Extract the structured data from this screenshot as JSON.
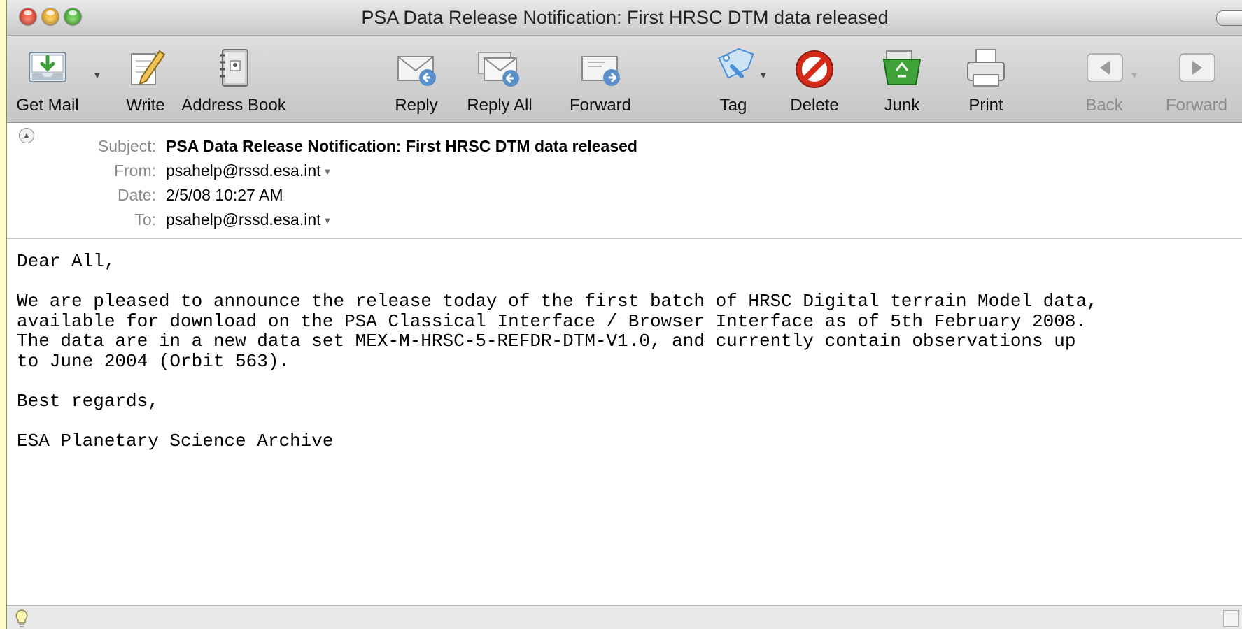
{
  "window": {
    "title": "PSA Data Release Notification: First HRSC DTM data released"
  },
  "toolbar": {
    "get_mail": "Get Mail",
    "write": "Write",
    "address_book": "Address Book",
    "reply": "Reply",
    "reply_all": "Reply All",
    "forward": "Forward",
    "tag": "Tag",
    "delete": "Delete",
    "junk": "Junk",
    "print": "Print",
    "back": "Back",
    "forward_nav": "Forward"
  },
  "header": {
    "subject_label": "Subject:",
    "subject": "PSA Data Release Notification: First HRSC DTM data released",
    "from_label": "From:",
    "from": "psahelp@rssd.esa.int",
    "date_label": "Date:",
    "date": "2/5/08 10:27 AM",
    "to_label": "To:",
    "to": "psahelp@rssd.esa.int"
  },
  "body": {
    "greeting": "Dear All,",
    "paragraph": "We are pleased to announce the release today of the first batch of HRSC Digital terrain Model data,\navailable for download on the PSA Classical Interface / Browser Interface as of 5th February 2008.\nThe data are in a new data set MEX-M-HRSC-5-REFDR-DTM-V1.0, and currently contain observations up\nto June 2004 (Orbit 563).",
    "closing": "Best regards,",
    "signature": "ESA Planetary Science Archive"
  },
  "icons": {
    "get_mail": "inbox-download-icon",
    "write": "pencil-paper-icon",
    "address_book": "address-book-icon",
    "reply": "reply-envelope-icon",
    "reply_all": "reply-all-envelope-icon",
    "forward": "forward-envelope-icon",
    "tag": "tag-icon",
    "delete": "no-entry-icon",
    "junk": "recycle-bin-icon",
    "print": "printer-icon",
    "back": "back-arrow-icon",
    "forward_nav": "forward-arrow-icon",
    "activity": "lightbulb-icon"
  },
  "colors": {
    "page_background": "#fffbc9",
    "delete_red": "#d42a1a",
    "junk_green": "#3fa33a",
    "tag_blue": "#4a90d9"
  }
}
